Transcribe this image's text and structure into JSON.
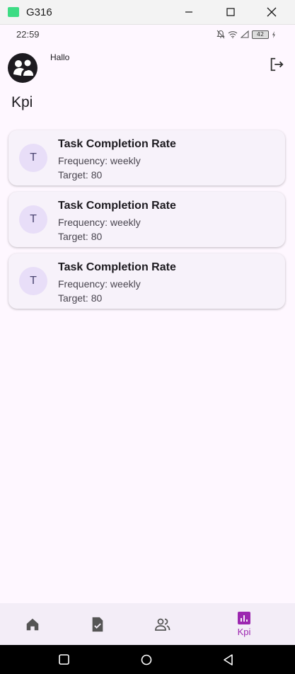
{
  "window": {
    "title": "G316"
  },
  "status_bar": {
    "time": "22:59",
    "battery": "42"
  },
  "header": {
    "greeting": "Hallo"
  },
  "page": {
    "title": "Kpi"
  },
  "kpis": [
    {
      "avatar_letter": "T",
      "name": "Task Completion Rate",
      "frequency": "Frequency: weekly",
      "target": "Target: 80"
    },
    {
      "avatar_letter": "T",
      "name": "Task Completion Rate",
      "frequency": "Frequency: weekly",
      "target": "Target: 80"
    },
    {
      "avatar_letter": "T",
      "name": "Task Completion Rate",
      "frequency": "Frequency: weekly",
      "target": "Target: 80"
    }
  ],
  "bottom_nav": {
    "items": [
      {
        "icon": "home-icon",
        "label": ""
      },
      {
        "icon": "task-check-icon",
        "label": ""
      },
      {
        "icon": "people-icon",
        "label": ""
      },
      {
        "icon": "chart-icon",
        "label": "Kpi",
        "selected": true
      }
    ]
  },
  "colors": {
    "accent": "#9c27b0",
    "background": "#fef7ff",
    "card": "#f7f2fa",
    "avatar_bg": "#e8def8"
  }
}
